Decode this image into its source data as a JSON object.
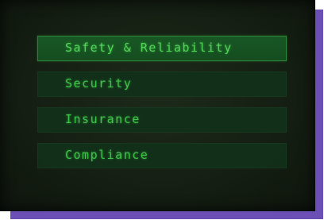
{
  "menu": {
    "items": [
      {
        "label": "Safety & Reliability",
        "selected": true
      },
      {
        "label": "Security",
        "selected": false
      },
      {
        "label": "Insurance",
        "selected": false
      },
      {
        "label": "Compliance",
        "selected": false
      }
    ]
  },
  "colors": {
    "accent_text": "#3fcf4a",
    "selected_bg": "#1a5a26",
    "screen_bg": "#151f13",
    "frame_shadow": "#6b4fb5"
  }
}
